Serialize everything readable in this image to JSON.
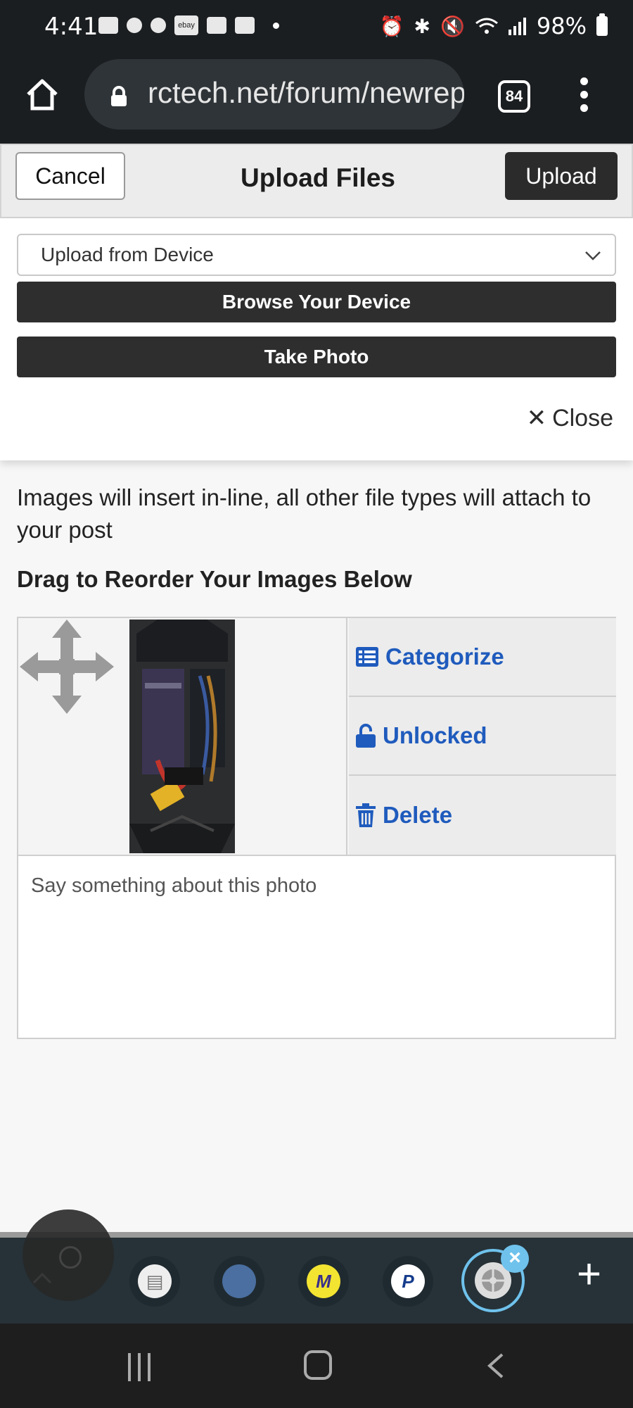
{
  "status_bar": {
    "time": "4:41",
    "battery": "98%",
    "icons": [
      "alarm-icon",
      "bluetooth-icon",
      "mute-icon",
      "wifi-icon",
      "signal-icon",
      "battery-icon"
    ]
  },
  "browser": {
    "url": "rctech.net/forum/newrep",
    "tab_count": "84"
  },
  "upload_header": {
    "cancel_label": "Cancel",
    "title": "Upload Files",
    "upload_label": "Upload"
  },
  "upload_panel": {
    "source_select": "Upload from Device",
    "browse_label": "Browse Your Device",
    "photo_label": "Take Photo",
    "close_label": "Close"
  },
  "main": {
    "info_text": "Images will insert in-line, all other file types will attach to your post",
    "reorder_heading": "Drag to Reorder Your Images Below"
  },
  "image_card": {
    "actions": [
      {
        "label": "Categorize",
        "icon": "list-icon"
      },
      {
        "label": "Unlocked",
        "icon": "unlock-icon"
      },
      {
        "label": "Delete",
        "icon": "trash-icon"
      }
    ],
    "caption_placeholder": "Say something about this photo"
  },
  "colors": {
    "accent_blue": "#1f5bbd",
    "dark_button": "#2e2e2e",
    "dock_bg": "#263238",
    "dock_active": "#6fc2ec"
  }
}
